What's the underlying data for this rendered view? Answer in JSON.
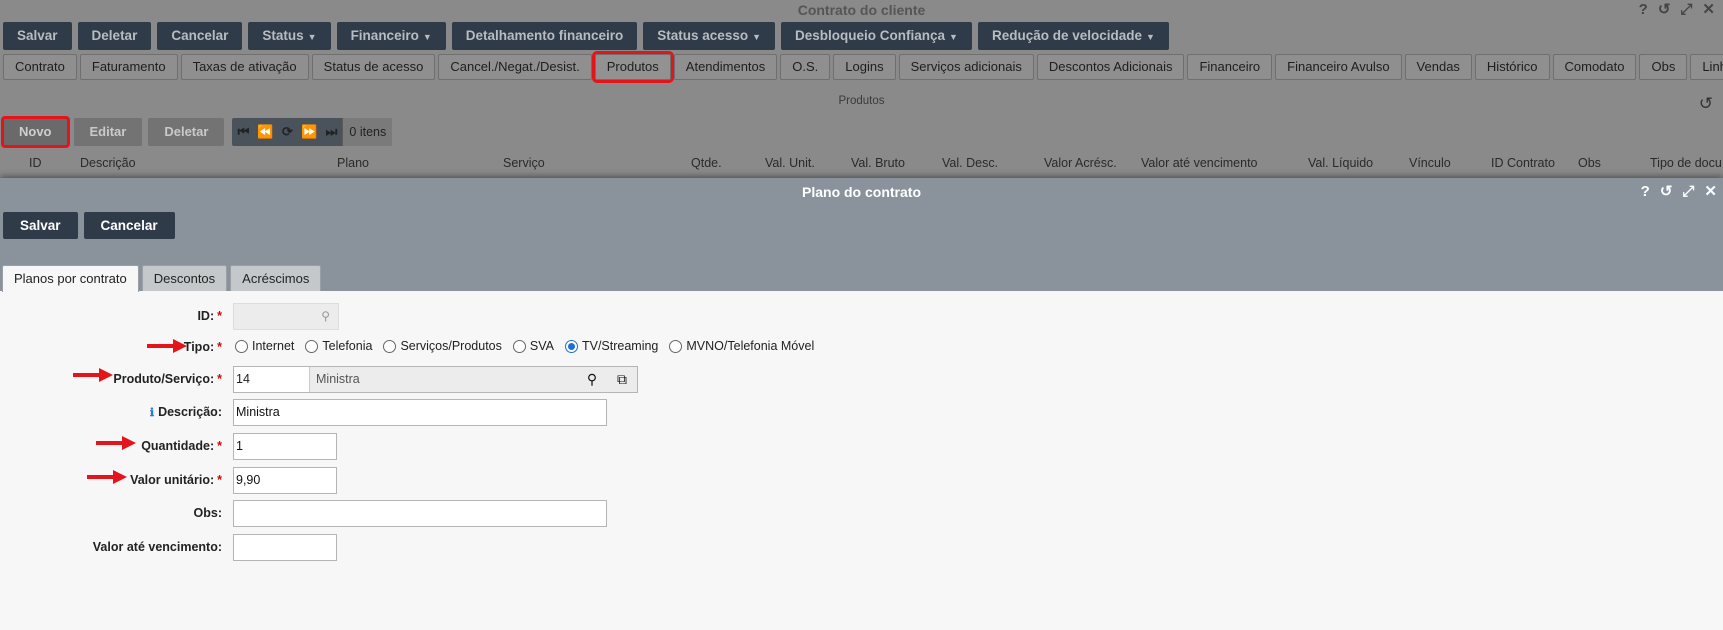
{
  "bg": {
    "title": "Contrato do cliente",
    "toolbar": [
      {
        "label": "Salvar",
        "caret": false
      },
      {
        "label": "Deletar",
        "caret": false
      },
      {
        "label": "Cancelar",
        "caret": false
      },
      {
        "label": "Status",
        "caret": true
      },
      {
        "label": "Financeiro",
        "caret": true
      },
      {
        "label": "Detalhamento financeiro",
        "caret": false
      },
      {
        "label": "Status acesso",
        "caret": true
      },
      {
        "label": "Desbloqueio Confiança",
        "caret": true
      },
      {
        "label": "Redução de velocidade",
        "caret": true
      }
    ],
    "tabs": [
      "Contrato",
      "Faturamento",
      "Taxas de ativação",
      "Status de acesso",
      "Cancel./Negat./Desist.",
      "Produtos",
      "Atendimentos",
      "O.S.",
      "Logins",
      "Serviços adicionais",
      "Descontos Adicionais",
      "Financeiro",
      "Financeiro Avulso",
      "Vendas",
      "Histórico",
      "Comodato",
      "Obs",
      "Linha SIP",
      "..."
    ],
    "highlighted_tab": "Produtos",
    "subtitle": "Produtos",
    "actions": {
      "novo": "Novo",
      "editar": "Editar",
      "deletar": "Deletar"
    },
    "pager_count": "0 itens",
    "columns": [
      "ID",
      "Descrição",
      "Plano",
      "Serviço",
      "Qtde.",
      "Val. Unit.",
      "Val. Bruto",
      "Val. Desc.",
      "Valor Acrésc.",
      "Valor até vencimento",
      "Val. Líquido",
      "Vínculo",
      "ID Contrato",
      "Obs",
      "Tipo de docu"
    ]
  },
  "modal": {
    "title": "Plano do contrato",
    "toolbar": {
      "save": "Salvar",
      "cancel": "Cancelar"
    },
    "tabs": [
      "Planos por contrato",
      "Descontos",
      "Acréscimos"
    ],
    "fields": {
      "id": {
        "label": "ID:",
        "value": ""
      },
      "tipo": {
        "label": "Tipo:",
        "options": [
          "Internet",
          "Telefonia",
          "Serviços/Produtos",
          "SVA",
          "TV/Streaming",
          "MVNO/Telefonia Móvel"
        ],
        "selected": "TV/Streaming"
      },
      "produto": {
        "label": "Produto/Serviço:",
        "code": "14",
        "desc": "Ministra"
      },
      "descricao": {
        "label": "Descrição:",
        "value": "Ministra"
      },
      "quantidade": {
        "label": "Quantidade:",
        "value": "1"
      },
      "valor_unitario": {
        "label": "Valor unitário:",
        "value": "9,90"
      },
      "obs": {
        "label": "Obs:",
        "value": ""
      },
      "valor_ate_vencimento": {
        "label": "Valor até vencimento:",
        "value": ""
      }
    }
  },
  "colors": {
    "highlight": "#e4151a",
    "dark_button": "#2f3b48",
    "radio_selected": "#1a6fd6"
  }
}
